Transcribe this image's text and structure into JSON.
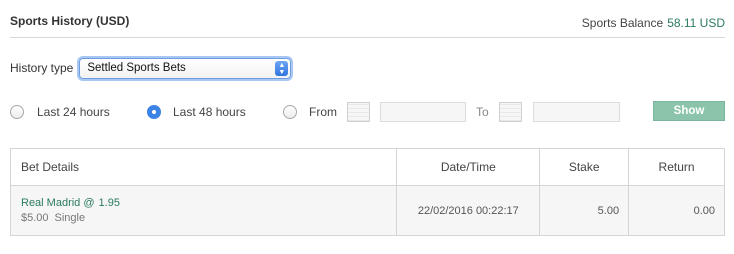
{
  "header": {
    "title": "Sports History (USD)",
    "balance_label": "Sports Balance",
    "balance_value": "58.11 USD"
  },
  "history": {
    "label": "History type",
    "selected": "Settled Sports Bets"
  },
  "range": {
    "option_24": "Last 24 hours",
    "option_48": "Last 48 hours",
    "option_from": "From",
    "to_label": "To",
    "selected": "Last 48 hours",
    "show_button": "Show"
  },
  "table": {
    "columns": [
      "Bet Details",
      "Date/Time",
      "Stake",
      "Return"
    ],
    "rows": [
      {
        "selection": "Real Madrid @",
        "odds": "1.95",
        "stake_display": "$5.00",
        "bet_type": "Single",
        "datetime": "22/02/2016 00:22:17",
        "stake": "5.00",
        "return": "0.00"
      }
    ]
  },
  "colors": {
    "accent_green": "#2b7a5d",
    "show_button_bg": "#8cc4ab",
    "radio_selected": "#3b82e6"
  }
}
